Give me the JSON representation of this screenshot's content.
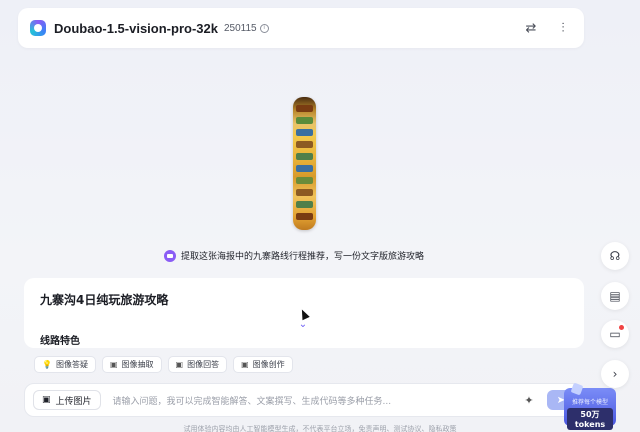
{
  "header": {
    "model_name": "Doubao-1.5-vision-pro-32k",
    "model_version": "250115",
    "info_icon": "info-icon",
    "swap_icon": "swap-icon",
    "settings_icon": "sliders-icon"
  },
  "conversation": {
    "user_prompt": "提取这张海报中的九寨路线行程推荐，写一份文字版旅游攻略",
    "answer_title": "九寨沟4日纯玩旅游攻略",
    "answer_section": "线路特色"
  },
  "chips": [
    {
      "label": "图像答疑",
      "icon": "bulb-icon"
    },
    {
      "label": "图像抽取",
      "icon": "extract-icon"
    },
    {
      "label": "图像回答",
      "icon": "image-icon"
    },
    {
      "label": "图像创作",
      "icon": "create-icon"
    }
  ],
  "input": {
    "upload_label": "上传图片",
    "placeholder": "请输入问题，我可以完成智能解答、文案撰写、生成代码等多种任务..."
  },
  "promo": {
    "line1": "推荐每个模型",
    "line2": "50万tokens"
  },
  "footer": "试用体验内容均由人工智能模型生成，不代表平台立场，免责声明、测试协议、隐私政策",
  "side_buttons": [
    "headset-icon",
    "book-icon",
    "feedback-icon",
    "chevron-right-icon"
  ],
  "colors": {
    "accent": "#8a5cf5",
    "send": "#a9b7f5",
    "promo": "#4a57e0"
  }
}
